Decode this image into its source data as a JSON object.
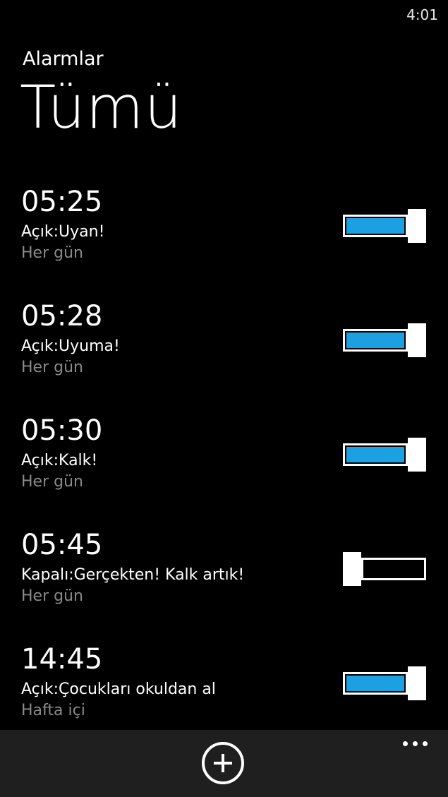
{
  "status_bar": {
    "time": "4:01"
  },
  "header": {
    "app_title": "Alarmlar",
    "page_title": "Tümü"
  },
  "colors": {
    "accent": "#1ba1e2",
    "background": "#000000",
    "app_bar": "#1f1f1f",
    "secondary_text": "#8a8a8a"
  },
  "alarms": [
    {
      "time": "05:25",
      "label": "Açık:Uyan!",
      "repeat": "Her gün",
      "enabled": true
    },
    {
      "time": "05:28",
      "label": "Açık:Uyuma!",
      "repeat": "Her gün",
      "enabled": true
    },
    {
      "time": "05:30",
      "label": "Açık:Kalk!",
      "repeat": "Her gün",
      "enabled": true
    },
    {
      "time": "05:45",
      "label": "Kapalı:Gerçekten! Kalk artık!",
      "repeat": "Her gün",
      "enabled": false
    },
    {
      "time": "14:45",
      "label": "Açık:Çocukları okuldan al",
      "repeat": "Hafta içi",
      "enabled": true
    }
  ],
  "app_bar": {
    "add_icon": "plus-circle-icon",
    "more_icon": "ellipsis-icon"
  }
}
